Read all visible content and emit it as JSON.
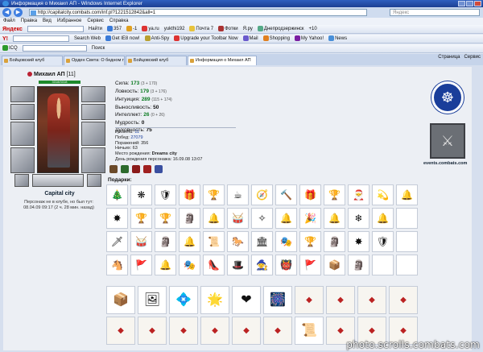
{
  "window": {
    "title": "Информация о Михаил АП - Windows Internet Explorer"
  },
  "address": {
    "url": "http://capitalcity.combats.com/inf.pl?1221512842&all=1",
    "search_placeholder": "Яндекс"
  },
  "menu": [
    "Файл",
    "Правка",
    "Вид",
    "Избранное",
    "Сервис",
    "Справка"
  ],
  "toolbar1": {
    "logo": "Яндекс",
    "find": "Найти",
    "items": [
      "357",
      "-1",
      "ya.ru",
      "yukthi192",
      "Почта 7",
      "Фотки",
      "Я.ру",
      "Днепродзержинск",
      "+10"
    ]
  },
  "toolbar2": {
    "logo": "Y!",
    "search_web": "Search Web",
    "items": [
      "Get IE8 now!",
      "Anti-Spy",
      "Upgrade your Toolbar Now",
      "Mail",
      "Shopping",
      "My Yahoo!",
      "News"
    ]
  },
  "toolbar3": {
    "items": [
      "ICQ",
      "Поиск"
    ]
  },
  "tabs": [
    {
      "label": "Бойцовский клуб",
      "active": false
    },
    {
      "label": "Орден Света: О бедном гу...",
      "active": false
    },
    {
      "label": "Бойцовский клуб",
      "active": false
    },
    {
      "label": "Информация о Михаил АП",
      "active": true
    }
  ],
  "tab_tools": {
    "page": "Страница",
    "tools": "Сервис"
  },
  "character": {
    "name": "Михаил АП",
    "level": "[11]",
    "hp": "3318/3318",
    "city": "Capital city",
    "presence_line1": "Персонаж не в клубе, но был тут:",
    "presence_line2": "08.04.09 09:17 (2 ч. 28 мин. назад)"
  },
  "stats": [
    {
      "label": "Сила:",
      "value": "173",
      "bonus": "(3 + 170)"
    },
    {
      "label": "Ловкость:",
      "value": "179",
      "bonus": "(3 + 176)"
    },
    {
      "label": "Интуиция:",
      "value": "289",
      "bonus": "(115 + 174)"
    },
    {
      "label": "Выносливость:",
      "value": "50",
      "bonus": ""
    },
    {
      "label": "Интеллект:",
      "value": "26",
      "bonus": "(0 + 26)"
    },
    {
      "label": "Мудрость:",
      "value": "0",
      "bonus": ""
    },
    {
      "label": "Духовность:",
      "value": "75",
      "bonus": ""
    }
  ],
  "info": {
    "level_label": "Уровень:",
    "level": "11",
    "wins_label": "Побед:",
    "wins": "27079",
    "losses_label": "Поражений:",
    "losses": "356",
    "draws_label": "Ничьих:",
    "draws": "63",
    "birthplace_label": "Место рождения:",
    "birthplace": "Dreams city",
    "birthday_label": "День рождения персонажа:",
    "birthday": "16.09.08 13:07"
  },
  "gifts_label": "Подарки:",
  "gifts": [
    "🎄",
    "❋",
    "🛡",
    "🎁",
    "🏆",
    "☕",
    "🧭",
    "🔨",
    "🎁",
    "🏆",
    "🎅",
    "💫",
    "🔔",
    "✸",
    "🏆",
    "🏆",
    "🗿",
    "🔔",
    "🥁",
    "✧",
    "🔔",
    "🎉",
    "🔔",
    "❄",
    "🔔",
    "",
    "🗡",
    "🥁",
    "🗿",
    "🔔",
    "📜",
    "🐎",
    "🏛",
    "🎭",
    "🏆",
    "🗿",
    "✸",
    "🛡",
    "",
    "🐴",
    "🚩",
    "🔔",
    "🎭",
    "👠",
    "🎩",
    "🧙",
    "👹",
    "🚩",
    "📦",
    "🗿",
    "",
    ""
  ],
  "big_items": [
    "📦",
    "🖼",
    "💠",
    "🌟",
    "❤",
    "🎆",
    "card",
    "card",
    "card",
    "card",
    "card",
    "card",
    "card",
    "card",
    "card",
    "card",
    "📜",
    "card",
    "card",
    "card"
  ],
  "events_link": "events.combats.com",
  "watermark": "photo.scrolls.combats.com",
  "colors": {
    "hp_green": "#1d8a2b",
    "stat_green": "#0a7a20",
    "clan_blue": "#1a3e9a"
  }
}
